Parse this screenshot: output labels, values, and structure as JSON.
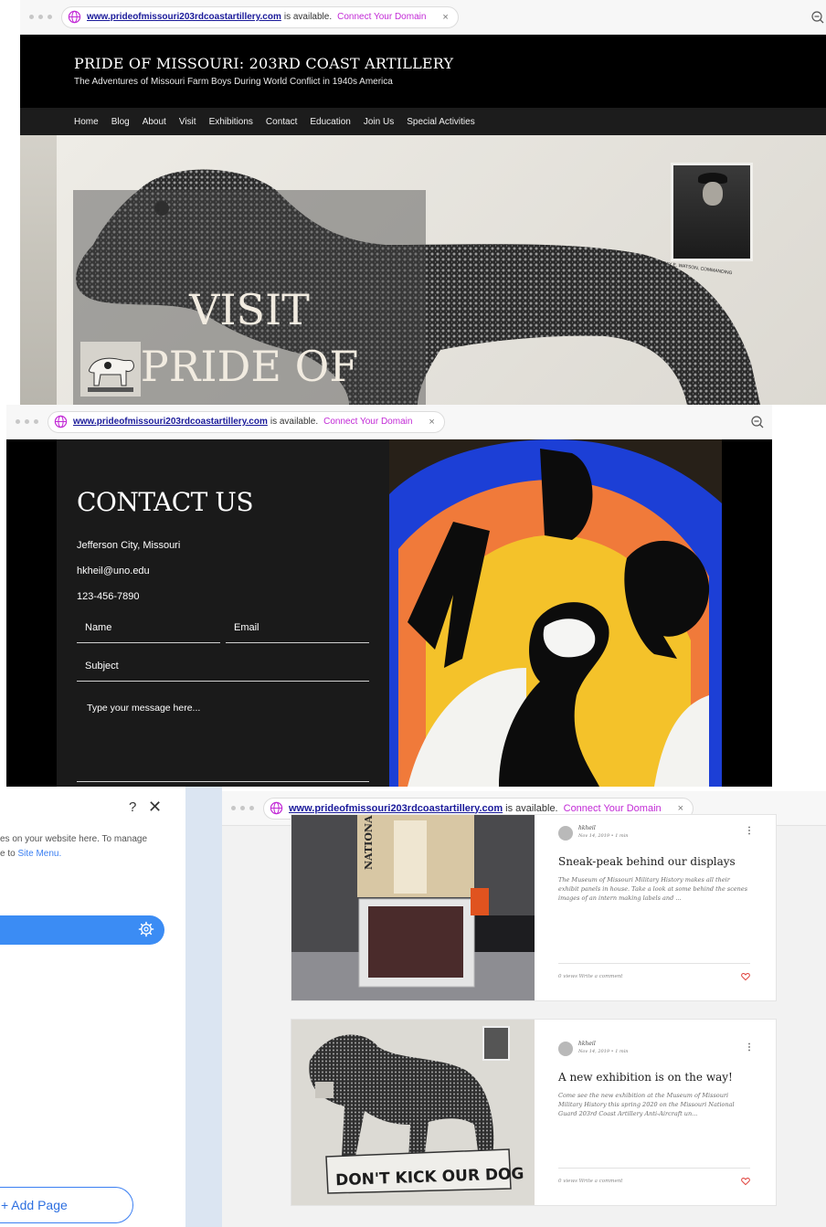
{
  "browser": {
    "url": "www.prideofmissouri203rdcoastartillery.com",
    "available_text": "is available.",
    "connect_text": "Connect Your Domain",
    "close_glyph": "×"
  },
  "site": {
    "title": "PRIDE OF MISSOURI: 203RD COAST ARTILLERY",
    "subtitle": "The Adventures of Missouri Farm Boys During World Conflict in 1940s America",
    "nav": [
      "Home",
      "Blog",
      "About",
      "Visit",
      "Exhibitions",
      "Contact",
      "Education",
      "Join Us",
      "Special Activities"
    ]
  },
  "hero": {
    "line1": "VISIT",
    "line2": "PRIDE OF",
    "photo_caption": "COL. RAY E. WATSON, COMMANDING"
  },
  "contact": {
    "title": "CONTACT US",
    "address": "Jefferson City, Missouri",
    "email": "hkheil@uno.edu",
    "phone": "123-456-7890",
    "name_label": "Name",
    "email_label": "Email",
    "subject_label": "Subject",
    "message_placeholder": "Type your message here..."
  },
  "pages_panel": {
    "help_glyph": "?",
    "close_glyph": "✕",
    "desc_line1": "es on your website here. To manage",
    "desc_line2_prefix": "e to",
    "desc_link": "Site Menu.",
    "add_page_label": "+ Add Page"
  },
  "blog": {
    "posts": [
      {
        "author": "hkheil",
        "meta": "Nov 14, 2019  •  1 min",
        "title": "Sneak-peak behind our displays",
        "excerpt": "The Museum of Missouri Military History makes all their exhibit panels in house. Take a look at some behind the scenes images of an intern making labels and ...",
        "stats": "0 views    Write a comment",
        "image_text": "NATIONAL GUARD"
      },
      {
        "author": "hkheil",
        "meta": "Nov 14, 2019  •  1 min",
        "title": "A new exhibition is on the way!",
        "excerpt": "Come see the new exhibition at the Museum of Missouri Military History this spring 2020 on the Missouri National Guard 203rd Coast Artillery Anti-Aircraft un...",
        "stats": "0 views    Write a comment",
        "image_text": "DON'T KICK OUR DOG"
      }
    ]
  },
  "colors": {
    "connect": "#c22ad6",
    "url": "#1a1a9a",
    "panel_accent": "#3b8cf4",
    "heart": "#e0443e"
  }
}
